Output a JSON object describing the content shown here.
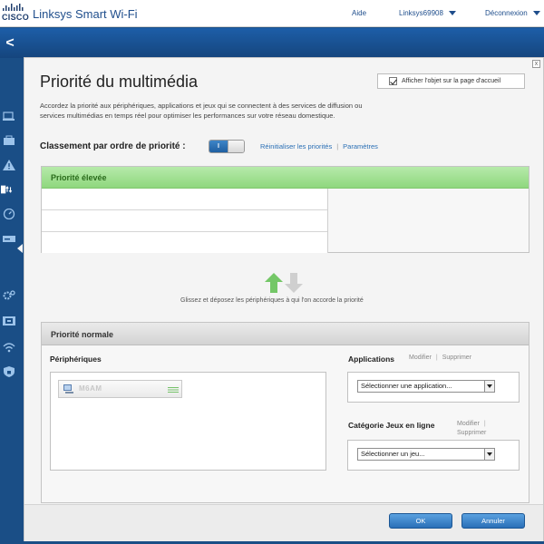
{
  "header": {
    "brand": "CISCO",
    "app_title": "Linksys Smart Wi-Fi",
    "help": "Aide",
    "account": "Linksys69908",
    "logout": "Déconnexion"
  },
  "nav": {
    "back": "<",
    "icons": [
      "network-map-icon",
      "guest-access-icon",
      "parental-controls-icon",
      "media-prioritization-icon",
      "speed-test-icon",
      "external-storage-icon",
      "connectivity-icon",
      "troubleshooting-icon",
      "wireless-icon",
      "security-icon"
    ]
  },
  "page": {
    "title": "Priorité du multimédia",
    "description": "Accordez la priorité aux périphériques, applications et jeux qui se connectent à des services de diffusion ou services multimédias en temps réel pour optimiser les performances sur votre réseau domestique.",
    "show_on_home": "Afficher l'objet sur la page d'accueil",
    "show_on_home_checked": true,
    "close": "x"
  },
  "ranking": {
    "label": "Classement par ordre de priorité :",
    "toggle_on": "I",
    "reset_link": "Réinitialiser les priorités",
    "separator": "|",
    "settings_link": "Paramètres"
  },
  "high_priority": {
    "title": "Priorité élevée",
    "rows": [
      "",
      "",
      ""
    ]
  },
  "drag_hint": "Glissez et déposez les périphériques à qui l'on accorde la priorité",
  "normal_priority": {
    "title": "Priorité normale",
    "devices_label": "Périphériques",
    "device_name": "M6AM",
    "applications_label": "Applications",
    "app_edit": "Modifier",
    "app_delete": "Supprimer",
    "app_select": "Sélectionner une application...",
    "games_label": "Catégorie Jeux en ligne",
    "games_edit": "Modifier",
    "games_delete": "Supprimer",
    "games_select": "Sélectionner un jeu..."
  },
  "footer": {
    "ok": "OK",
    "cancel": "Annuler"
  },
  "colors": {
    "accent_blue": "#1f5fa0",
    "high_priority_green": "#8fd77e",
    "sidebar": "#1a4e86"
  }
}
